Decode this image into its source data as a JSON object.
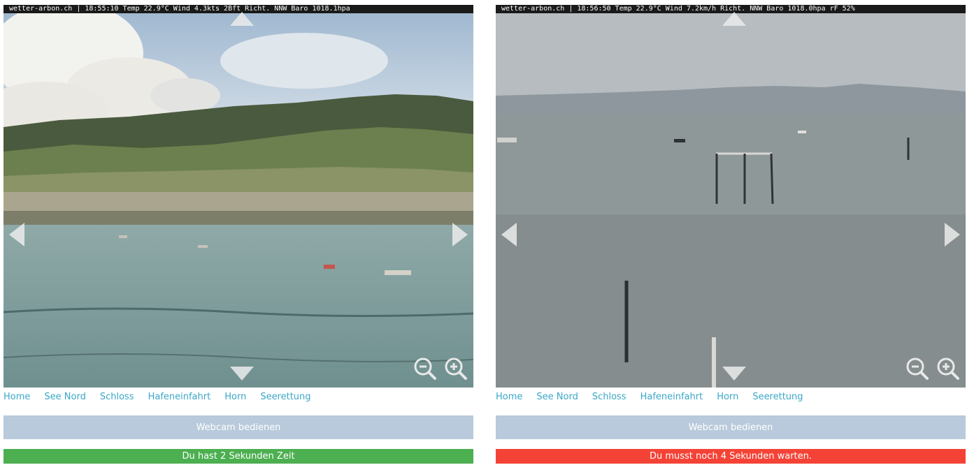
{
  "cams": [
    {
      "overlay": "wetter-arbon.ch | 18:55:10 Temp 22.9°C Wind 4.3kts 2Bft Richt. NNW Baro 1018.1hpa",
      "nav": [
        "Home",
        "See Nord",
        "Schloss",
        "Hafeneinfahrt",
        "Horn",
        "Seerettung"
      ],
      "button": "Webcam bedienen",
      "status": "Du hast 2 Sekunden Zeit",
      "status_color": "#4caf50"
    },
    {
      "overlay": "wetter-arbon.ch | 18:56:50 Temp 22.9°C Wind 7.2km/h Richt. NNW Baro 1018.0hpa rF 52%",
      "nav": [
        "Home",
        "See Nord",
        "Schloss",
        "Hafeneinfahrt",
        "Horn",
        "Seerettung"
      ],
      "button": "Webcam bedienen",
      "status": "Du musst noch 4 Sekunden warten.",
      "status_color": "#f44336"
    }
  ],
  "icons": {
    "up": "arrow-up-icon",
    "down": "arrow-down-icon",
    "left": "arrow-left-icon",
    "right": "arrow-right-icon",
    "zoom_out": "zoom-out-icon",
    "zoom_in": "zoom-in-icon"
  }
}
